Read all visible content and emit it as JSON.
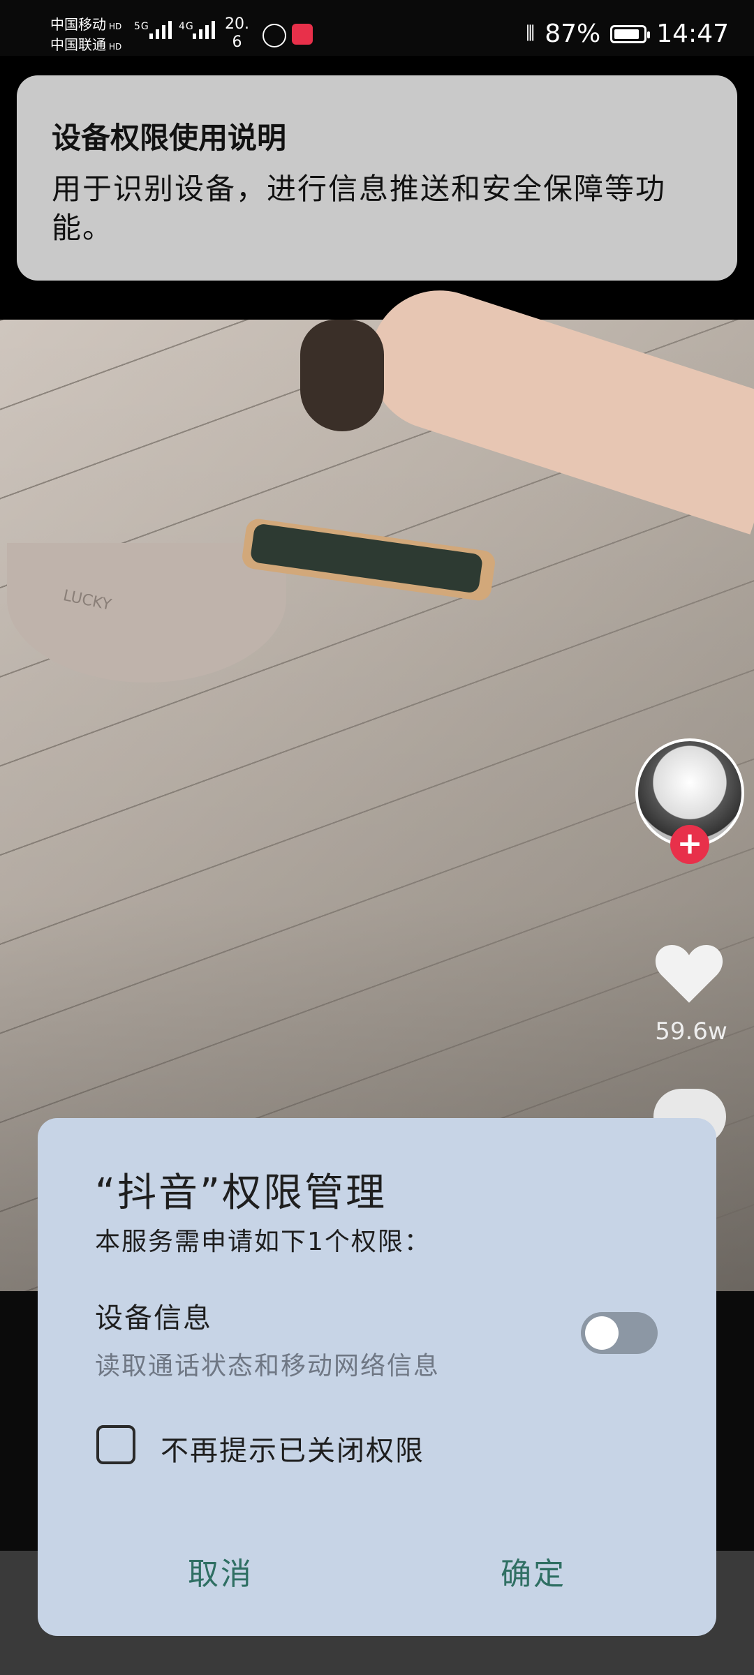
{
  "status_bar": {
    "carrier_1": "中国移动",
    "carrier_2": "中国联通",
    "hd_1": "HD",
    "hd_2": "HD",
    "net_1": "5G",
    "net_2": "4G",
    "speed": "20.\n6",
    "battery_percent": "87%",
    "battery_level": 0.87,
    "time": "14:47"
  },
  "notice": {
    "title": "设备权限使用说明",
    "body": "用于识别设备，进行信息推送和安全保障等功能。"
  },
  "video": {
    "like_count": "59.6w",
    "follow_symbol": "+",
    "basin_text": "LUCKY"
  },
  "dialog": {
    "title": "“抖音”权限管理",
    "subtitle": "本服务需申请如下1个权限：",
    "permission_name": "设备信息",
    "permission_desc": "读取通话状态和移动网络信息",
    "permission_enabled": false,
    "checkbox_label": "不再提示已关闭权限",
    "checkbox_checked": false,
    "cancel_label": "取消",
    "confirm_label": "确定"
  },
  "colors": {
    "dialog_bg": "#c7d4e6",
    "button_text": "#2f6f63",
    "follow_red": "#e8304a",
    "notice_bg": "#c9c9c9"
  }
}
